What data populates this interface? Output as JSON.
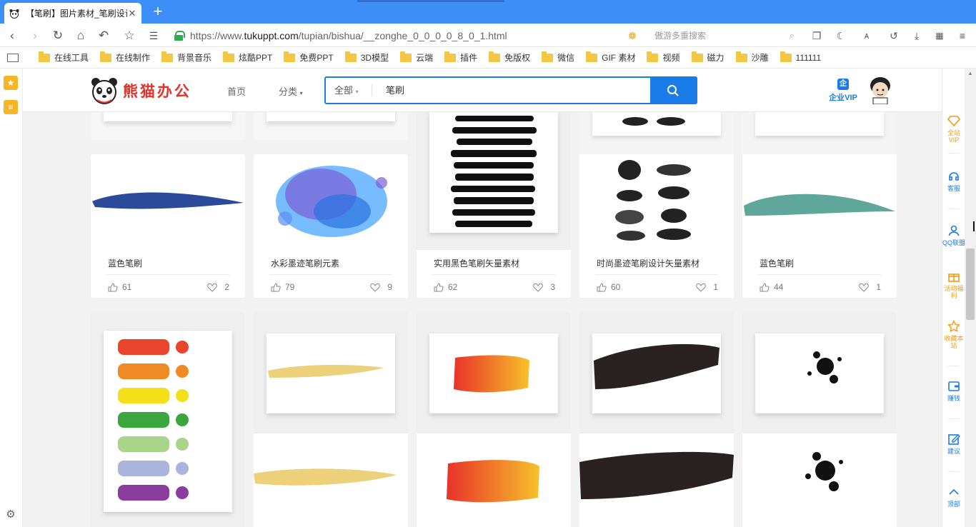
{
  "browser": {
    "tab_title": "【笔刷】图片素材_笔刷设计",
    "tab_close": "✕",
    "new_tab": "+",
    "url_prefix": "https://www.",
    "url_domain": "tukuppt.com",
    "url_path": "/tupian/bishua/__zonghe_0_0_0_0_8_0_1.html",
    "search_placeholder": "傲游多重搜索"
  },
  "bookmarks": [
    {
      "label": "在线工具"
    },
    {
      "label": "在线制作"
    },
    {
      "label": "背景音乐"
    },
    {
      "label": "炫酷PPT"
    },
    {
      "label": "免费PPT"
    },
    {
      "label": "3D模型"
    },
    {
      "label": "云端"
    },
    {
      "label": "插件"
    },
    {
      "label": "免版权"
    },
    {
      "label": "微信"
    },
    {
      "label": "GIF 素材"
    },
    {
      "label": "视频"
    },
    {
      "label": "磁力"
    },
    {
      "label": "沙雕"
    },
    {
      "label": "111111"
    }
  ],
  "site": {
    "logo_text": "熊猫办公",
    "nav_home": "首页",
    "nav_category": "分类",
    "search_category": "全部",
    "search_query": "笔刷",
    "vip_label": "企业VIP"
  },
  "cards_row1": [
    {
      "title": "蓝色笔刷",
      "likes": "61",
      "favs": "2"
    },
    {
      "title": "水彩墨迹笔刷元素",
      "likes": "79",
      "favs": "9"
    },
    {
      "title": "实用黑色笔刷矢量素材",
      "likes": "62",
      "favs": "3"
    },
    {
      "title": "时尚墨迹笔刷设计矢量素材",
      "likes": "60",
      "favs": "1"
    },
    {
      "title": "蓝色笔刷",
      "likes": "44",
      "favs": "1"
    }
  ],
  "right_sidebar": [
    {
      "label": "全站VIP",
      "icon": "diamond-icon"
    },
    {
      "label": "客服",
      "icon": "headset-icon"
    },
    {
      "label": "QQ联盟",
      "icon": "user-icon"
    },
    {
      "label": "活动福利",
      "icon": "gift-icon"
    },
    {
      "label": "收藏本站",
      "icon": "star-icon"
    },
    {
      "label": "赚钱",
      "icon": "wallet-icon"
    },
    {
      "label": "建议",
      "icon": "edit-icon"
    },
    {
      "label": "顶部",
      "icon": "chevron-up-icon"
    }
  ],
  "colors": {
    "browser_blue": "#3e8ef7",
    "site_blue": "#1a7ce8",
    "logo_red": "#e4322b",
    "vip_orange": "#f39c12"
  }
}
